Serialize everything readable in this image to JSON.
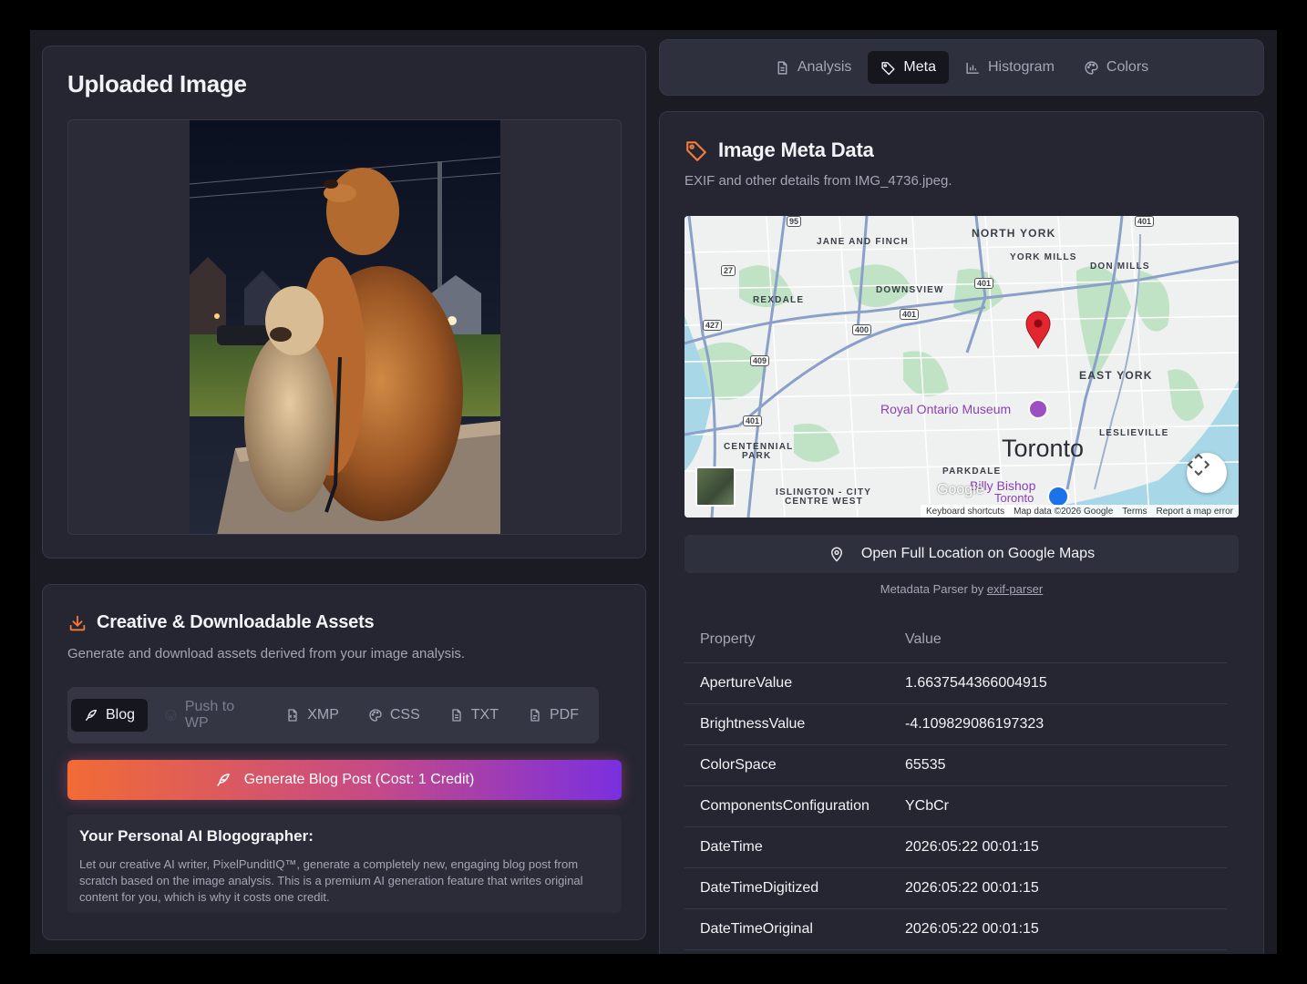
{
  "upload": {
    "title": "Uploaded Image"
  },
  "assets": {
    "title": "Creative & Downloadable Assets",
    "subtitle": "Generate and download assets derived from your image analysis.",
    "tabs": [
      {
        "label": "Blog",
        "icon": "feather-icon"
      },
      {
        "label": "Push to WP",
        "icon": "wordpress-icon"
      },
      {
        "label": "XMP",
        "icon": "file-code-icon"
      },
      {
        "label": "CSS",
        "icon": "palette-icon"
      },
      {
        "label": "TXT",
        "icon": "file-text-icon"
      },
      {
        "label": "PDF",
        "icon": "file-icon"
      }
    ],
    "generate_label": "Generate Blog Post (Cost: 1 Credit)",
    "info_title": "Your Personal AI Blogographer:",
    "info_text": "Let our creative AI writer, PixelPunditIQ™, generate a completely new, engaging blog post from scratch based on the image analysis. This is a premium AI generation feature that writes original content for you, which is why it costs one credit."
  },
  "tabs": [
    {
      "label": "Analysis",
      "icon": "document-icon"
    },
    {
      "label": "Meta",
      "icon": "tag-icon"
    },
    {
      "label": "Histogram",
      "icon": "bar-chart-icon"
    },
    {
      "label": "Colors",
      "icon": "palette-icon"
    }
  ],
  "meta": {
    "title": "Image Meta Data",
    "subtitle": "EXIF and other details from IMG_4736.jpeg.",
    "open_maps_label": "Open Full Location on Google Maps",
    "parser_prefix": "Metadata Parser by ",
    "parser_link": "exif-parser",
    "table_headers": [
      "Property",
      "Value"
    ],
    "rows": [
      {
        "property": "ApertureValue",
        "value": "1.6637544366004915"
      },
      {
        "property": "BrightnessValue",
        "value": "-4.109829086197323"
      },
      {
        "property": "ColorSpace",
        "value": "65535"
      },
      {
        "property": "ComponentsConfiguration",
        "value": "YCbCr"
      },
      {
        "property": "DateTime",
        "value": "2026:05:22 00:01:15"
      },
      {
        "property": "DateTimeDigitized",
        "value": "2026:05:22 00:01:15"
      },
      {
        "property": "DateTimeOriginal",
        "value": "2026:05:22 00:01:15"
      }
    ]
  },
  "map": {
    "labels": {
      "north_york": "NORTH YORK",
      "jane_finch": "JANE AND FINCH",
      "york_mills": "YORK MILLS",
      "don_mills": "DON MILLS",
      "downsview": "DOWNSVIEW",
      "rexdale": "REXDALE",
      "east_york": "EAST YORK",
      "rom": "Royal Ontario Museum",
      "leslieville": "LESLIEVILLE",
      "centennial": "CENTENNIAL",
      "park": "PARK",
      "toronto": "Toronto",
      "parkdale": "PARKDALE",
      "billy_bishop": "Billy Bishop",
      "billy_toronto": "Toronto",
      "islington": "ISLINGTON - CITY",
      "centre_west": "CENTRE WEST",
      "google": "Google"
    },
    "shields": [
      "95",
      "401",
      "27",
      "401",
      "427",
      "400",
      "401",
      "409",
      "401"
    ],
    "footer": [
      "Keyboard shortcuts",
      "Map data ©2026 Google",
      "Terms",
      "Report a map error"
    ]
  },
  "colors": {
    "accent_orange": "#f27a3a",
    "gradient_start": "#f26b35",
    "gradient_end": "#7a2fe0",
    "pin_red": "#e3262f",
    "rom_purple": "#9c4fc2"
  }
}
